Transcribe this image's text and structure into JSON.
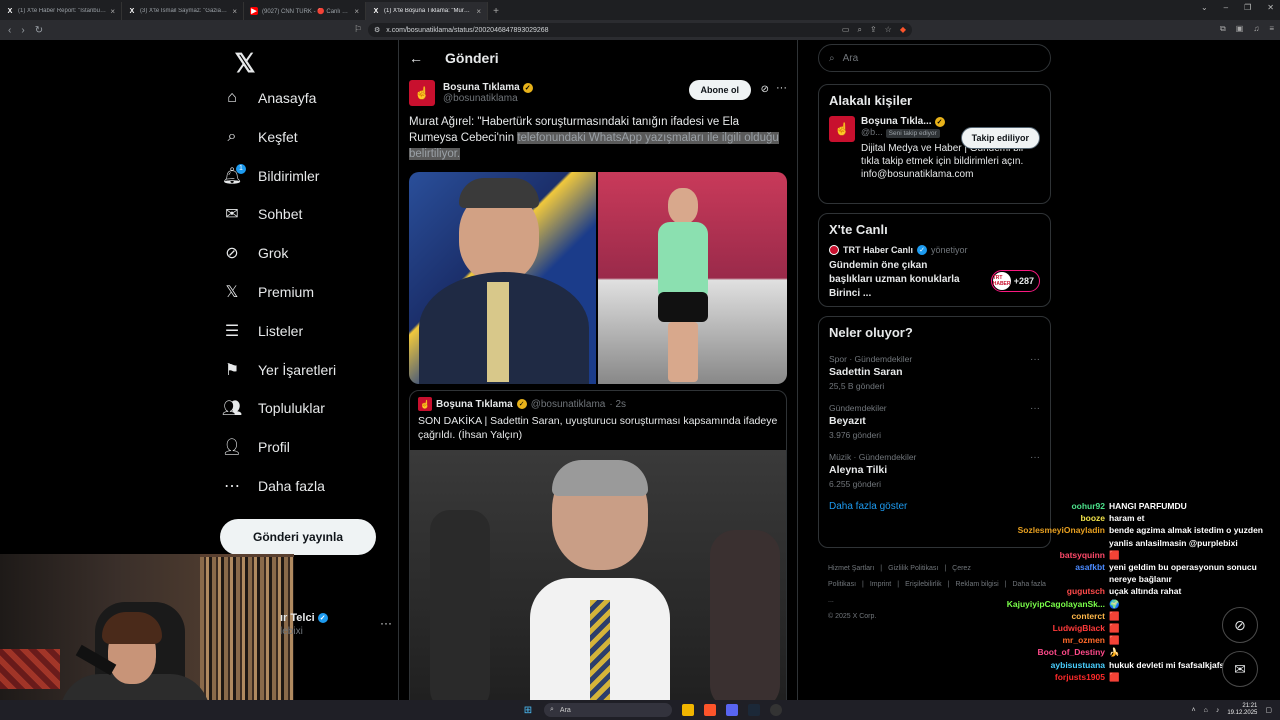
{
  "browser": {
    "tabs": [
      {
        "title": "(1) X'te Haber Report: \"İstanbul Başsa...",
        "icon": "x-icon",
        "active": false
      },
      {
        "title": "(3) X'te İsmail Saymaz: \"Gaziantep'in ...",
        "icon": "x-icon",
        "active": false
      },
      {
        "title": "(9027) CNN TÜRK - 🔴 Canlı Yayın ᴴᴰ",
        "icon": "youtube-icon",
        "active": false
      },
      {
        "title": "(1) X'te Boşuna Tıklama: \"Murat ...",
        "icon": "x-icon",
        "active": true
      }
    ],
    "url": "x.com/bosunatiklama/status/2002046847893029268"
  },
  "nav": {
    "items": [
      {
        "label": "Anasayfa",
        "icon": "home-icon"
      },
      {
        "label": "Keşfet",
        "icon": "search-icon"
      },
      {
        "label": "Bildirimler",
        "icon": "bell-icon",
        "badge": "1"
      },
      {
        "label": "Sohbet",
        "icon": "mail-icon"
      },
      {
        "label": "Grok",
        "icon": "grok-icon"
      },
      {
        "label": "Premium",
        "icon": "x-premium-icon"
      },
      {
        "label": "Listeler",
        "icon": "list-icon"
      },
      {
        "label": "Yer İşaretleri",
        "icon": "bookmark-icon"
      },
      {
        "label": "Topluluklar",
        "icon": "communities-icon"
      },
      {
        "label": "Profil",
        "icon": "profile-icon"
      },
      {
        "label": "Daha fazla",
        "icon": "more-circle-icon"
      }
    ],
    "post_button": "Gönderi yayınla",
    "account": {
      "name": "ır Telci",
      "handle": "lebixi"
    }
  },
  "main": {
    "header": "Gönderi",
    "post": {
      "author": "Boşuna Tıklama",
      "handle": "@bosunatiklama",
      "subscribe": "Abone ol",
      "text_plain": "Murat Ağırel: \"Habertürk soruşturmasındaki tanığın ifadesi ve Ela Rumeysa Cebeci'nin ",
      "text_selected": "telefonundaki WhatsApp yazışmaları ile ilgili olduğu belirtiliyor."
    },
    "quote": {
      "author": "Boşuna Tıklama",
      "handle": "@bosunatiklama",
      "time": "· 2s",
      "text": "SON DAKİKA | Sadettin Saran, uyuşturucu soruşturması kapsamında ifadeye çağrıldı. (İhsan Yalçın)"
    }
  },
  "right": {
    "search_placeholder": "Ara",
    "related": {
      "title": "Alakalı kişiler",
      "name": "Boşuna Tıkla...",
      "handle": "@b...",
      "follows_you": "Seni takip ediyor",
      "follow_btn": "Takip ediliyor",
      "bio": "Dijital Medya ve Haber | Gündemi bir tıkla takip etmek için bildirimleri açın. info@bosunatiklama.com"
    },
    "live": {
      "title": "X'te Canlı",
      "host": "TRT Haber Canlı",
      "managing": "yönetiyor",
      "text": "Gündemin öne çıkan başlıkları uzman konuklarla Birinci ...",
      "listeners": "+287",
      "badge_text": "TRT HABER"
    },
    "trends": {
      "title": "Neler oluyor?",
      "items": [
        {
          "category": "Spor · Gündemdekiler",
          "name": "Sadettin Saran",
          "count": "25,5 B gönderi"
        },
        {
          "category": "Gündemdekiler",
          "name": "Beyazıt",
          "count": "3.976 gönderi"
        },
        {
          "category": "Müzik · Gündemdekiler",
          "name": "Aleyna Tilki",
          "count": "6.255 gönderi"
        }
      ],
      "show_more": "Daha fazla göster"
    },
    "footer": {
      "links": [
        "Hizmet Şartları",
        "|",
        "Gizlilik Politikası",
        "|",
        "Çerez Politikası",
        "|",
        "Imprint",
        "|",
        "Erişilebilirlik",
        "|",
        "Reklam bilgisi",
        "|",
        "Daha fazla ..."
      ],
      "copyright": "© 2025 X Corp."
    }
  },
  "chat": [
    {
      "user": "oohur92",
      "msg": "HANGI PARFUMDU",
      "color": "#4be08a"
    },
    {
      "user": "booze",
      "msg": "haram et",
      "color": "#f2e34a"
    },
    {
      "user": "SozlesmeyiOnayladin",
      "msg": "bende agzima almak istedim o yuzden yanlis anlasilmasin @purplebixi",
      "color": "#e8a020"
    },
    {
      "user": "batsyquinn",
      "msg": "🟥",
      "color": "#ff4a6a"
    },
    {
      "user": "asafkbt",
      "msg": "yeni geldim bu operasyonun sonucu nereye bağlanır",
      "color": "#4a8aff"
    },
    {
      "user": "gugutsch",
      "msg": "uçak altında rahat",
      "color": "#ff4a4a"
    },
    {
      "user": "KajuyiyipCagolayanSk...",
      "msg": "🌍",
      "color": "#7aff4a"
    },
    {
      "user": "conterct",
      "msg": "🟥",
      "color": "#ffb84a"
    },
    {
      "user": "LudwigBlack",
      "msg": "🟥",
      "color": "#ff3a3a"
    },
    {
      "user": "mr_ozmen",
      "msg": "🟥",
      "color": "#ff6a2a"
    },
    {
      "user": "Boot_of_Destiny",
      "msg": "🍌",
      "color": "#ff4a8a"
    },
    {
      "user": "aybisustuana",
      "msg": "hukuk devleti mi fsafsalkjafs",
      "color": "#4ad0ff"
    },
    {
      "user": "forjusts1905",
      "msg": "🟥",
      "color": "#ff2a2a"
    }
  ],
  "taskbar": {
    "search": "Ara",
    "time": "21:21",
    "date": "19.12.2025"
  }
}
